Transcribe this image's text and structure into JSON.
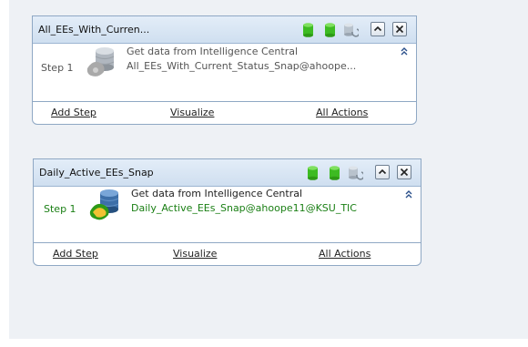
{
  "cards": [
    {
      "title": "All_EEs_With_Curren...",
      "step_label": "Step 1",
      "action_text": "Get data from Intelligence Central",
      "source_text": "All_EEs_With_Current_Status_Snap@ahoope...",
      "footer": {
        "add_step": "Add Step",
        "visualize": "Visualize",
        "all_actions": "All Actions"
      },
      "state": "inactive"
    },
    {
      "title": "Daily_Active_EEs_Snap",
      "step_label": "Step 1",
      "action_text": "Get data from Intelligence Central",
      "source_text": "Daily_Active_EEs_Snap@ahoope11@KSU_TIC",
      "footer": {
        "add_step": "Add Step",
        "visualize": "Visualize",
        "all_actions": "All Actions"
      },
      "state": "active"
    }
  ],
  "icons": {
    "header": [
      "green-database-icon",
      "green-database-icon",
      "gray-database-refresh-icon",
      "collapse-up-button",
      "close-button"
    ],
    "step": "database-step-icon",
    "collapse": "double-chevron-up-icon"
  },
  "colors": {
    "accent_green": "#1a7f14",
    "db_green": "#3dbb22",
    "header_blue": "#cfdff0",
    "border_blue": "#8fa8c4"
  }
}
